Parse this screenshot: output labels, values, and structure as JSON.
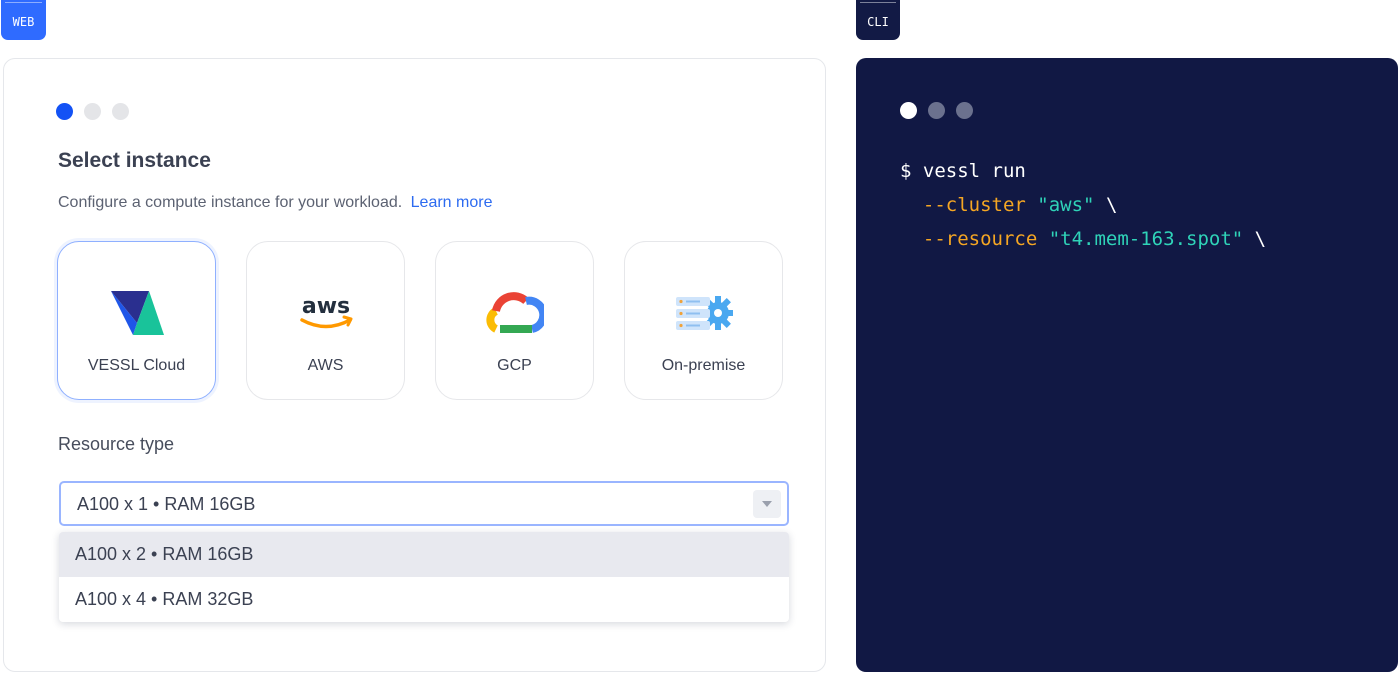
{
  "tags": {
    "web": "WEB",
    "cli": "CLI"
  },
  "web": {
    "title": "Select instance",
    "subtitle": "Configure a compute instance for your workload.",
    "learn_more": "Learn more",
    "cards": [
      {
        "label": "VESSL Cloud",
        "icon": "vessl-logo-icon",
        "selected": true
      },
      {
        "label": "AWS",
        "icon": "aws-logo-icon",
        "selected": false
      },
      {
        "label": "GCP",
        "icon": "gcp-cloud-icon",
        "selected": false
      },
      {
        "label": "On-premise",
        "icon": "server-gear-icon",
        "selected": false
      }
    ],
    "resource_label": "Resource type",
    "resource_selected": "A100 x 1 • RAM 16GB",
    "resource_options": [
      "A100 x 2 • RAM 16GB",
      "A100 x 4 • RAM 32GB"
    ],
    "step_dots": {
      "count": 3,
      "active": 1
    }
  },
  "cli": {
    "line1": {
      "prompt": "$ vessl run"
    },
    "line2": {
      "flag": "--cluster",
      "value": "\"aws\"",
      "cont": "\\"
    },
    "line3": {
      "flag": "--resource",
      "value": "\"t4.mem-163.spot\"",
      "cont": "\\"
    }
  },
  "colors": {
    "accent": "#1352f5",
    "link": "#2d6bf0",
    "cli_bg": "#111844",
    "cli_flag": "#f5a623",
    "cli_string": "#2fd3b8"
  }
}
